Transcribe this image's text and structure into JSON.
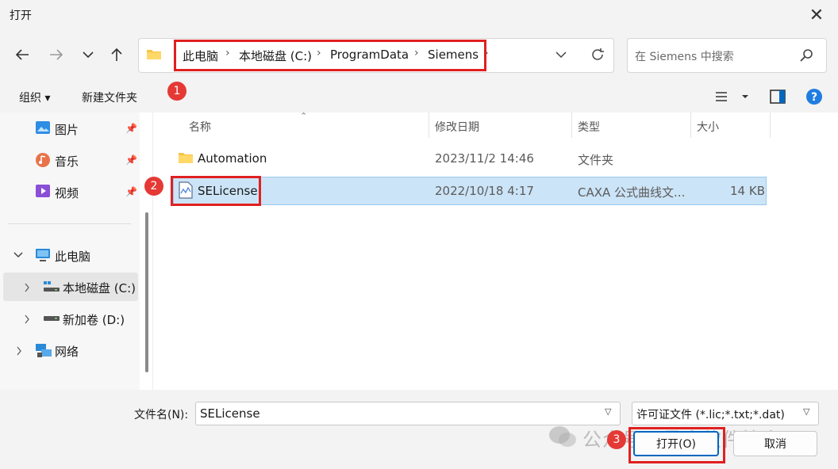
{
  "window": {
    "title": "打开",
    "close_glyph": "✕"
  },
  "address": {
    "breadcrumbs": [
      "此电脑",
      "本地磁盘 (C:)",
      "ProgramData",
      "Siemens"
    ],
    "separator": "›"
  },
  "search": {
    "placeholder": "在 Siemens 中搜索"
  },
  "commandbar": {
    "organize": "组织 ▾",
    "new_folder": "新建文件夹"
  },
  "navpane": {
    "quick": [
      {
        "label": "图片",
        "icon": "pictures-icon"
      },
      {
        "label": "音乐",
        "icon": "music-icon"
      },
      {
        "label": "视频",
        "icon": "videos-icon"
      }
    ],
    "this_pc": "此电脑",
    "drive_c": "本地磁盘 (C:)",
    "drive_d": "新加卷 (D:)",
    "network": "网络"
  },
  "columns": {
    "name": "名称",
    "modified": "修改日期",
    "type": "类型",
    "size": "大小"
  },
  "files": [
    {
      "name": "Automation",
      "modified": "2023/11/2 14:46",
      "type": "文件夹",
      "size": "",
      "icon": "folder-icon"
    },
    {
      "name": "SELicense",
      "modified": "2022/10/18 4:17",
      "type": "CAXA 公式曲线文...",
      "size": "14 KB",
      "icon": "license-file-icon",
      "selected": true
    }
  ],
  "footer": {
    "filename_label": "文件名(N):",
    "filename_value": "SELicense",
    "filetype": "许可证文件 (*.lic;*.txt;*.dat)",
    "open_button": "打开(O)",
    "cancel_button": "取消"
  },
  "annotations": {
    "badge1": "1",
    "badge2": "2",
    "badge3": "3",
    "accent": "#e02020"
  },
  "watermark": "公众号 · 最全软件管家"
}
